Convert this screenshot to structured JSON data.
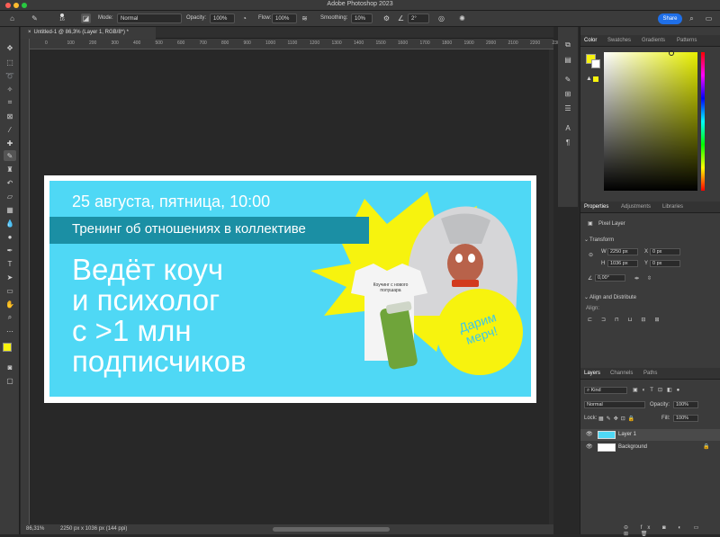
{
  "window": {
    "title": "Adobe Photoshop 2023",
    "traffic": [
      "#ff5f57",
      "#febc2e",
      "#28c840"
    ]
  },
  "options": {
    "brush_size": "16",
    "mode_label": "Mode:",
    "mode_value": "Normal",
    "opacity_label": "Opacity:",
    "opacity_value": "100%",
    "flow_label": "Flow:",
    "flow_value": "100%",
    "smoothing_label": "Smoothing:",
    "smoothing_value": "10%",
    "angle_value": "2°",
    "share_label": "Share"
  },
  "document": {
    "tab_title": "Untitled-1 @ 86,3% (Layer 1, RGB/8*) *",
    "zoom": "86,31%",
    "size_info": "2250 px x 1036 px (144 ppi)"
  },
  "ruler": {
    "top": [
      "0",
      "100",
      "200",
      "300",
      "400",
      "500",
      "600",
      "700",
      "800",
      "900",
      "1000",
      "1100",
      "1200",
      "1300",
      "1400",
      "1500",
      "1600",
      "1700",
      "1800",
      "1900",
      "2000",
      "2100",
      "2200",
      "2300"
    ]
  },
  "artwork": {
    "date_line": "25 августа, пятница, 10:00",
    "banner_text": "Тренинг об отношениях в коллективе",
    "headline": [
      "Ведёт коуч",
      "и психолог",
      "с >1 млн",
      "подписчиков"
    ],
    "promo_circle": "Дарим мерч!",
    "tshirt_text": "Коучинг с нового\nполушара",
    "colors": {
      "bg": "#4fd8f5",
      "burst": "#f7f30e",
      "banner": "#1b8fa4",
      "circle": "#f7f30e",
      "promo_text": "#3ec6e8"
    }
  },
  "panels": {
    "color_tabs": [
      "Color",
      "Swatches",
      "Gradients",
      "Patterns"
    ],
    "props_tabs": [
      "Properties",
      "Adjustments",
      "Libraries"
    ],
    "pixel_layer": "Pixel Layer",
    "transform": "Transform",
    "w_label": "W",
    "w_value": "2250 px",
    "x_label": "X",
    "x_value": "0 px",
    "h_label": "H",
    "h_value": "1036 px",
    "y_label": "Y",
    "y_value": "0 px",
    "angle_value": "0,00°",
    "align_title": "Align and Distribute",
    "align_label": "Align:",
    "layers_tabs": [
      "Layers",
      "Channels",
      "Paths"
    ],
    "kind": "Kind",
    "blend": "Normal",
    "opacity_label": "Opacity:",
    "opacity": "100%",
    "lock_label": "Lock:",
    "fill_label": "Fill:",
    "fill": "100%",
    "layers": [
      {
        "name": "Layer 1"
      },
      {
        "name": "Background"
      }
    ],
    "fg_color": "#f7f30e",
    "color_picker_hue": "#e8f000"
  }
}
